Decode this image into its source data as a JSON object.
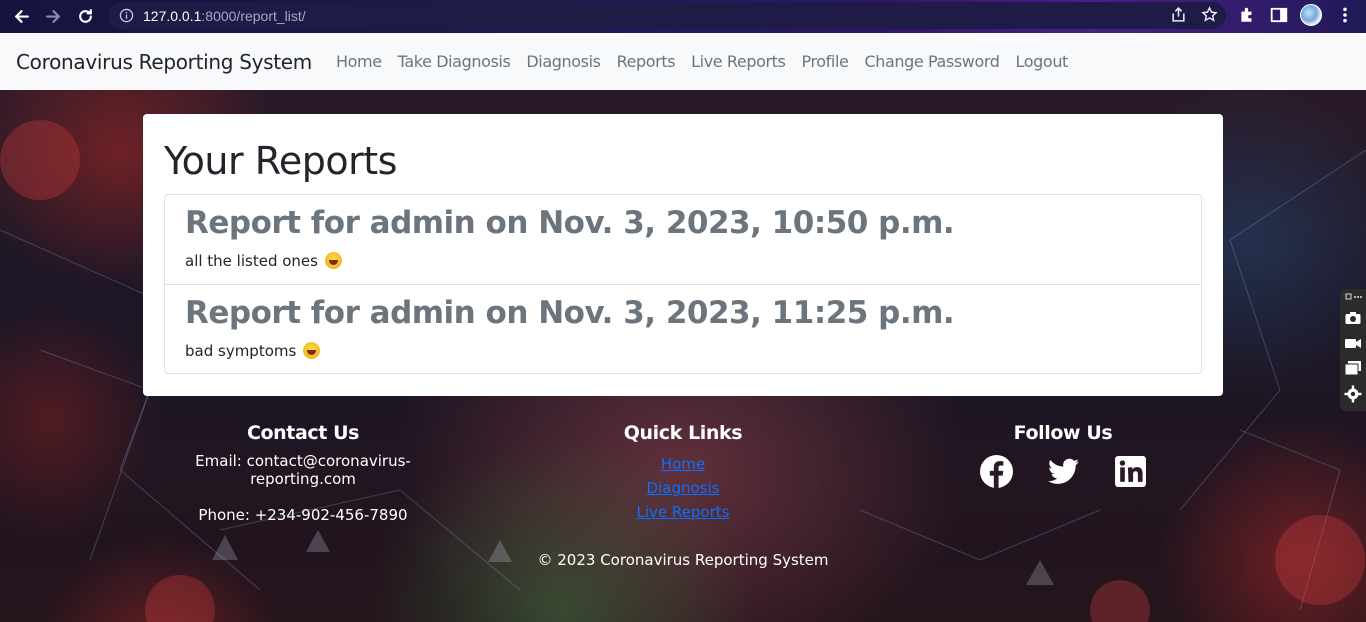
{
  "browser": {
    "url_host": "127.0.0.1",
    "url_rest": ":8000/report_list/"
  },
  "navbar": {
    "brand": "Coronavirus Reporting System",
    "links": [
      "Home",
      "Take Diagnosis",
      "Diagnosis",
      "Reports",
      "Live Reports",
      "Profile",
      "Change Password",
      "Logout"
    ]
  },
  "reports": {
    "heading": "Your Reports",
    "items": [
      {
        "title": "Report for admin on Nov. 3, 2023, 10:50 p.m.",
        "symptoms": "all the listed ones"
      },
      {
        "title": "Report for admin on Nov. 3, 2023, 11:25 p.m.",
        "symptoms": "bad symptoms"
      }
    ]
  },
  "footer": {
    "contact": {
      "title": "Contact Us",
      "email": "Email: contact@coronavirus-reporting.com",
      "phone": "Phone: +234-902-456-7890"
    },
    "quick_links": {
      "title": "Quick Links",
      "links": [
        "Home",
        "Diagnosis",
        "Live Reports"
      ]
    },
    "follow": {
      "title": "Follow Us",
      "icons": [
        "facebook-icon",
        "twitter-icon",
        "linkedin-icon"
      ]
    },
    "copyright": "© 2023 Coronavirus Reporting System"
  },
  "colors": {
    "navbar_bg": "#f8f9fa",
    "link_blue": "#0d6efd",
    "muted": "#6c757d"
  }
}
